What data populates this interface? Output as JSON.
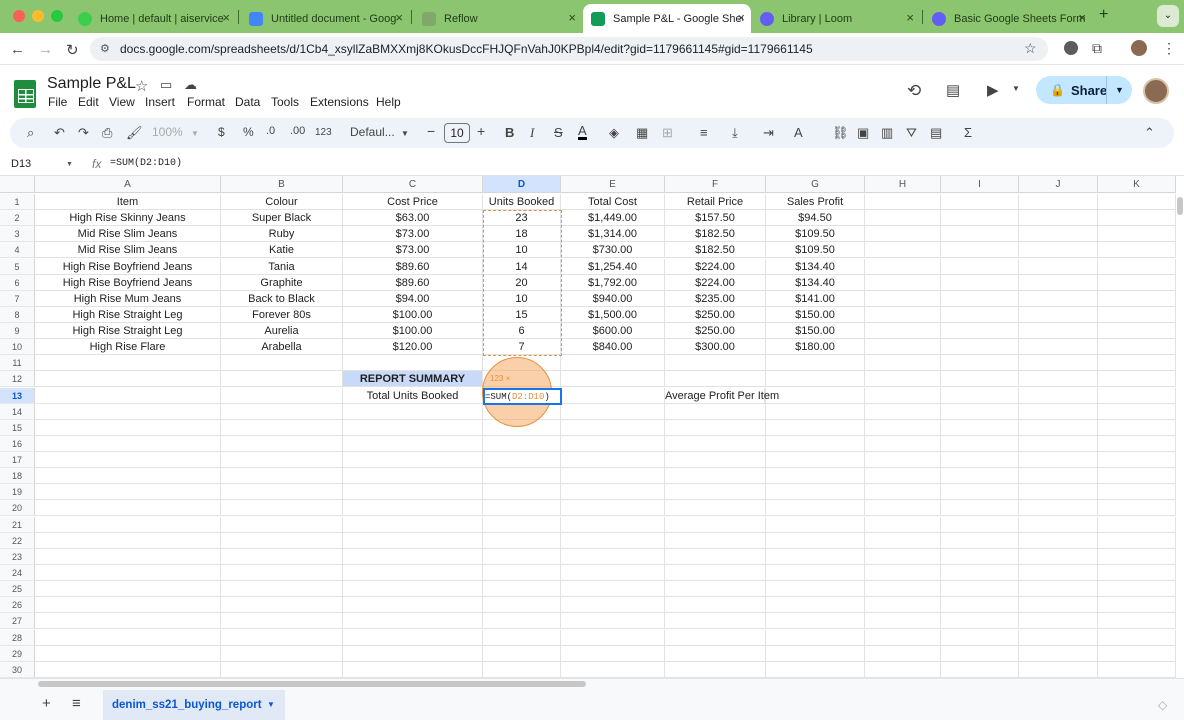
{
  "browser": {
    "tabs": [
      {
        "title": "Home | default | aiservice",
        "favicon_color": "#3ccf4e"
      },
      {
        "title": "Untitled document - Goog",
        "favicon_color": "#4285f4"
      },
      {
        "title": "Reflow",
        "favicon_color": "#7fa86a"
      },
      {
        "title": "Sample P&L - Google Shee",
        "favicon_color": "#0f9d58"
      },
      {
        "title": "Library | Loom",
        "favicon_color": "#625df5"
      },
      {
        "title": "Basic Google Sheets Form",
        "favicon_color": "#625df5"
      }
    ],
    "new_tab": "+",
    "url": "docs.google.com/spreadsheets/d/1Cb4_xsyllZaBMXXmj8KOkusDccFHJQFnVahJ0KPBpl4/edit?gid=1179661145#gid=1179661145"
  },
  "doc": {
    "title": "Sample P&L",
    "menus": [
      "File",
      "Edit",
      "View",
      "Insert",
      "Format",
      "Data",
      "Tools",
      "Extensions",
      "Help"
    ],
    "share_label": "Share"
  },
  "toolbar": {
    "zoom": "100%",
    "currency": "$",
    "percent": "%",
    "dec_dec": ".0",
    "inc_dec": ".00",
    "number_format": "123",
    "font": "Defaul...",
    "font_size": "10",
    "minus": "−",
    "plus": "+",
    "bold": "B",
    "italic": "I",
    "strike": "S",
    "text_color": "A"
  },
  "formula_bar": {
    "name_box": "D13",
    "fx": "fx",
    "formula": "=SUM(D2:D10)"
  },
  "grid": {
    "columns": [
      "A",
      "B",
      "C",
      "D",
      "E",
      "F",
      "G",
      "H",
      "I",
      "J",
      "K"
    ],
    "rows": [
      "1",
      "2",
      "3",
      "4",
      "5",
      "6",
      "7",
      "8",
      "9",
      "10",
      "11",
      "12",
      "13",
      "14",
      "15",
      "16",
      "17",
      "18",
      "19",
      "20",
      "21",
      "22",
      "23",
      "24",
      "25",
      "26",
      "27",
      "28",
      "29",
      "30"
    ],
    "header": [
      "Item",
      "Colour",
      "Cost Price",
      "Units Booked",
      "Total Cost",
      "Retail Price",
      "Sales Profit"
    ],
    "data": [
      [
        "High Rise Skinny Jeans",
        "Super Black",
        "$63.00",
        "23",
        "$1,449.00",
        "$157.50",
        "$94.50"
      ],
      [
        "Mid Rise Slim Jeans",
        "Ruby",
        "$73.00",
        "18",
        "$1,314.00",
        "$182.50",
        "$109.50"
      ],
      [
        "Mid Rise Slim Jeans",
        "Katie",
        "$73.00",
        "10",
        "$730.00",
        "$182.50",
        "$109.50"
      ],
      [
        "High Rise Boyfriend Jeans",
        "Tania",
        "$89.60",
        "14",
        "$1,254.40",
        "$224.00",
        "$134.40"
      ],
      [
        "High Rise Boyfriend Jeans",
        "Graphite",
        "$89.60",
        "20",
        "$1,792.00",
        "$224.00",
        "$134.40"
      ],
      [
        "High Rise Mum Jeans",
        "Back to Black",
        "$94.00",
        "10",
        "$940.00",
        "$235.00",
        "$141.00"
      ],
      [
        "High Rise Straight Leg",
        "Forever 80s",
        "$100.00",
        "15",
        "$1,500.00",
        "$250.00",
        "$150.00"
      ],
      [
        "High Rise Straight Leg",
        "Aurelia",
        "$100.00",
        "6",
        "$600.00",
        "$250.00",
        "$150.00"
      ],
      [
        "High Rise Flare",
        "Arabella",
        "$120.00",
        "7",
        "$840.00",
        "$300.00",
        "$180.00"
      ]
    ],
    "report_summary": "REPORT SUMMARY",
    "total_units_label": "Total Units Booked",
    "avg_profit_label": "Average Profit Per Item",
    "editor": {
      "prefix": "=SUM(",
      "range": "D2:D10",
      "suffix": ")"
    },
    "tooltip": "123 ×",
    "selected_col": "D",
    "selected_row": "13"
  },
  "sheets": {
    "add": "+",
    "list": "≡",
    "active_tab": "denim_ss21_buying_report"
  }
}
